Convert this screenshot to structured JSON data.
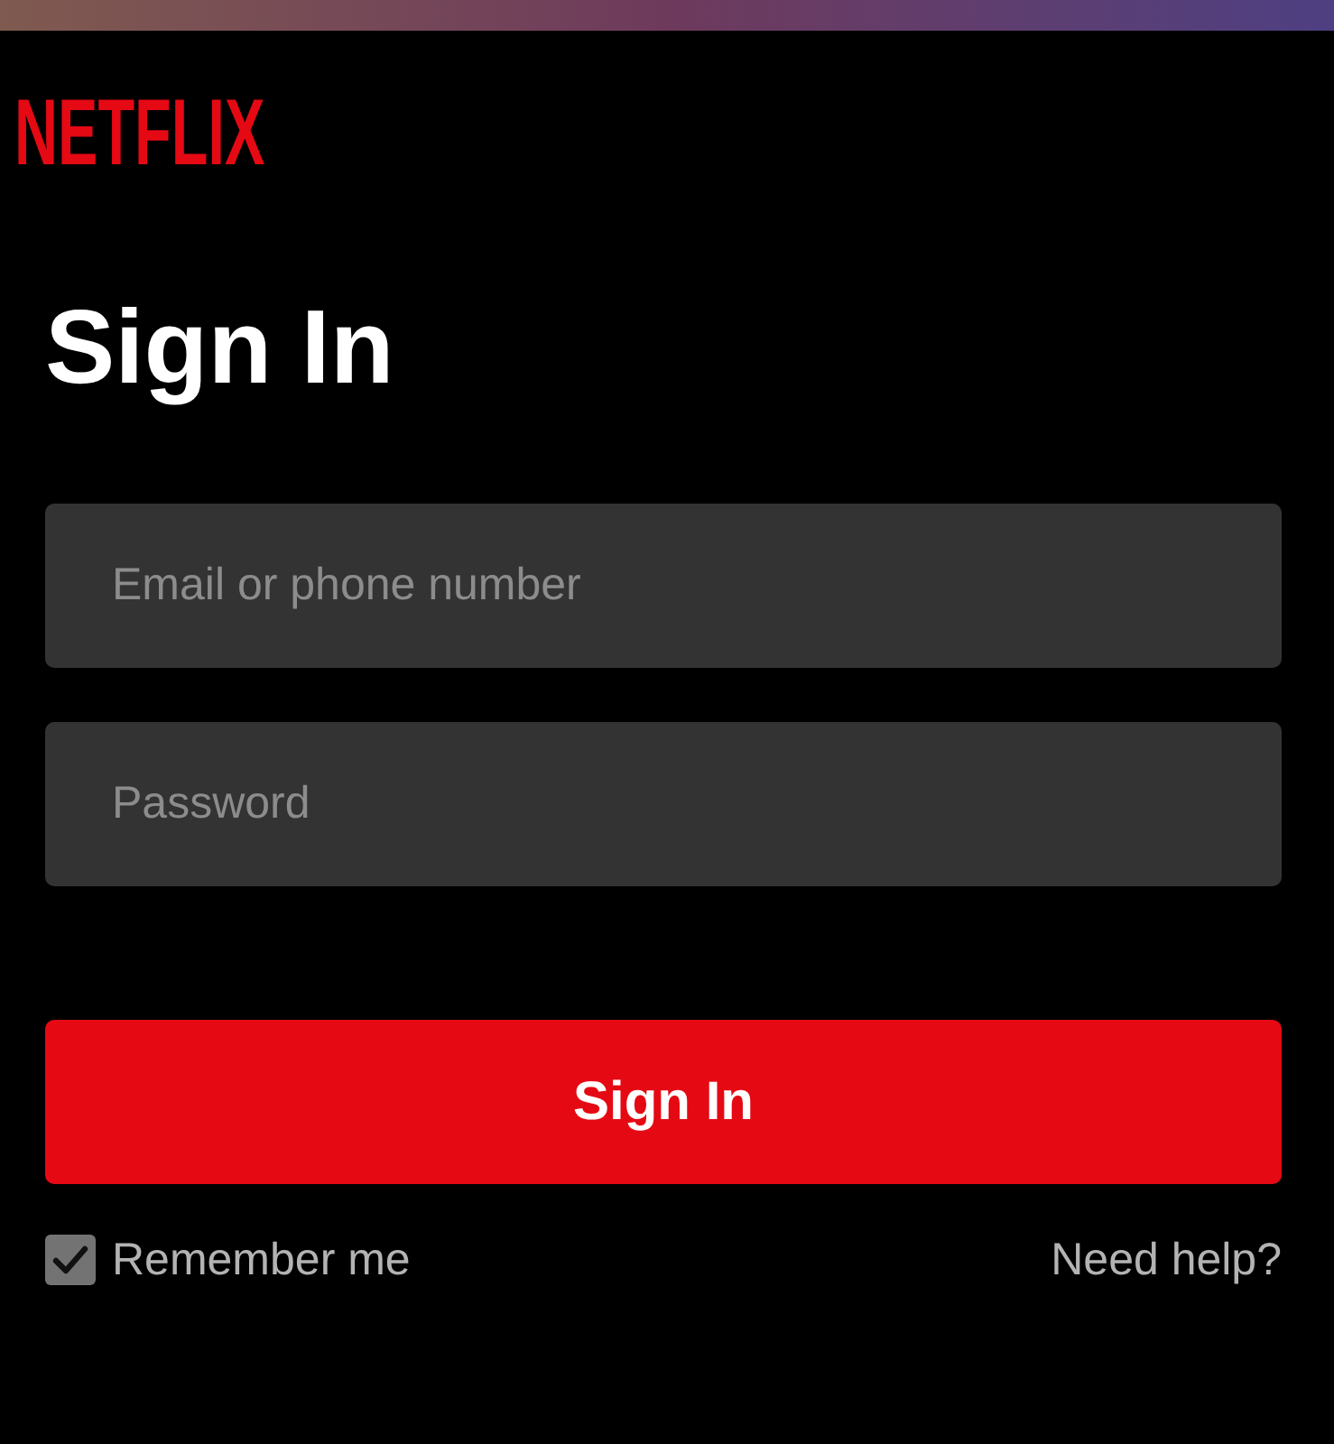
{
  "logo": "NETFLIX",
  "title": "Sign In",
  "fields": [
    {
      "placeholder": "Email or phone number"
    },
    {
      "placeholder": "Password"
    }
  ],
  "submit_button": "Sign In",
  "remember_me": {
    "label": "Remember me",
    "checked": true
  },
  "help_link": "Need help?"
}
